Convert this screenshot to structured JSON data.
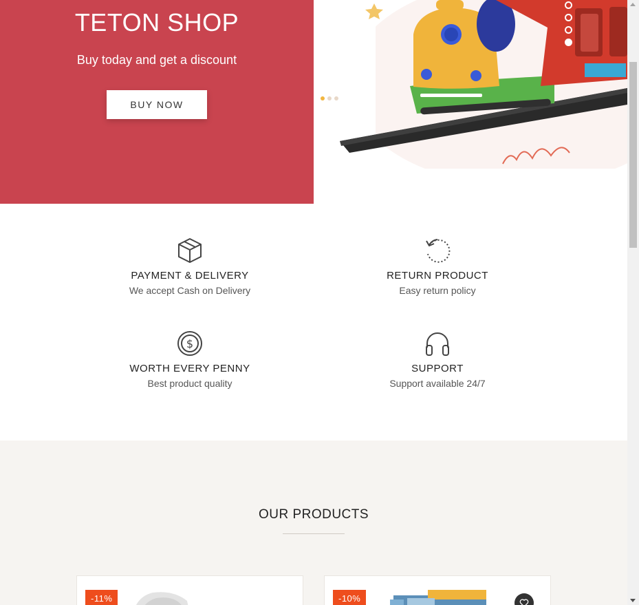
{
  "hero": {
    "title": "TETON SHOP",
    "subtitle": "Buy today and get a discount",
    "button_label": "BUY NOW",
    "accent_color": "#c9444f",
    "slide_dot_count": 3,
    "vertical_pager_count": 4
  },
  "features": [
    {
      "icon": "box-icon",
      "title": "PAYMENT & DELIVERY",
      "text": "We accept Cash on Delivery"
    },
    {
      "icon": "return-icon",
      "title": "RETURN PRODUCT",
      "text": "Easy return policy"
    },
    {
      "icon": "dollar-coin-icon",
      "title": "WORTH EVERY PENNY",
      "text": "Best product quality"
    },
    {
      "icon": "headphones-icon",
      "title": "SUPPORT",
      "text": "Support available 24/7"
    }
  ],
  "products": {
    "section_title": "OUR PRODUCTS",
    "items": [
      {
        "discount": "-11%"
      },
      {
        "discount": "-10%"
      }
    ],
    "badge_color": "#ee4d1d"
  }
}
